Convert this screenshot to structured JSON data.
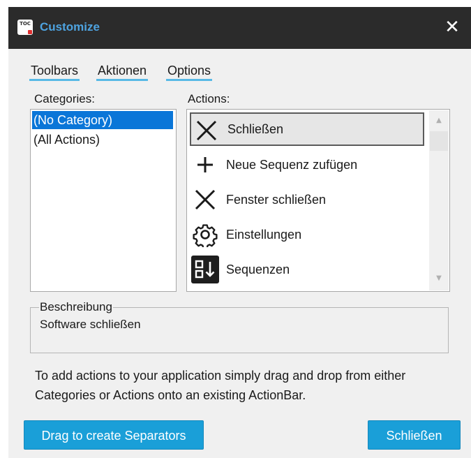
{
  "window": {
    "title": "Customize",
    "icon_text": "TOC",
    "close_glyph": "✕"
  },
  "tabs": [
    {
      "label": "Toolbars"
    },
    {
      "label": "Aktionen"
    },
    {
      "label": "Options"
    }
  ],
  "categories": {
    "label": "Categories:",
    "items": [
      {
        "label": "(No Category)",
        "selected": true
      },
      {
        "label": "(All Actions)",
        "selected": false
      }
    ]
  },
  "actions": {
    "label": "Actions:",
    "items": [
      {
        "label": "Schließen",
        "icon": "close-icon",
        "selected": true
      },
      {
        "label": "Neue Sequenz zufügen",
        "icon": "plus-icon",
        "selected": false
      },
      {
        "label": "Fenster schließen",
        "icon": "close-icon",
        "selected": false
      },
      {
        "label": "Einstellungen",
        "icon": "gear-icon",
        "selected": false
      },
      {
        "label": "Sequenzen",
        "icon": "sequence-sort-icon",
        "selected": false
      }
    ]
  },
  "description": {
    "legend": "Beschreibung",
    "text": "Software schließen"
  },
  "info_text": "To add actions to your application simply drag and drop from either Categories or Actions onto an existing ActionBar.",
  "buttons": {
    "separators": "Drag to create Separators",
    "close": "Schließen"
  },
  "colors": {
    "titlebar_bg": "#2b2b2b",
    "title_accent": "#4ea3e0",
    "button_bg": "#1a9fd8",
    "selection_bg": "#0a76d8",
    "tab_underline": "#58b9e6"
  }
}
